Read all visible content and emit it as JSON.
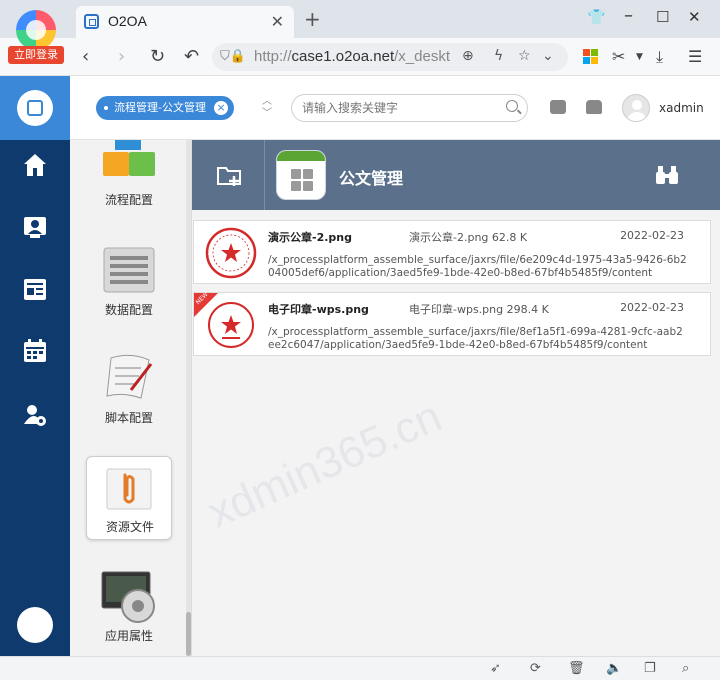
{
  "browser": {
    "login_label": "立即登录",
    "tab_title": "O2OA",
    "url_prefix": "http://",
    "url_host": "case1.o2oa.net",
    "url_path": "/x_deskt",
    "icons": [
      "back-icon",
      "forward-icon",
      "reload-icon",
      "undo-icon",
      "shield-icon",
      "zoom-icon",
      "flash-icon",
      "star-icon",
      "chevron-down-icon",
      "apps-icon",
      "scissors-icon",
      "download-icon",
      "more-icon"
    ]
  },
  "app": {
    "breadcrumb_pill": "流程管理-公文管理",
    "search_placeholder": "请输入搜索关键字",
    "username": "xadmin"
  },
  "nav": {
    "items": [
      "home-icon",
      "contacts-icon",
      "news-icon",
      "calendar-icon",
      "user-settings-icon"
    ]
  },
  "config": {
    "items": [
      {
        "label": "流程配置",
        "icon": "process-config-icon"
      },
      {
        "label": "数据配置",
        "icon": "data-config-icon"
      },
      {
        "label": "脚本配置",
        "icon": "script-config-icon"
      },
      {
        "label": "资源文件",
        "icon": "resource-file-icon",
        "active": true
      },
      {
        "label": "应用属性",
        "icon": "app-properties-icon"
      }
    ]
  },
  "main": {
    "title": "公文管理",
    "files": [
      {
        "name": "演示公章-2.png",
        "meta": "演示公章-2.png 62.8 K",
        "date": "2022-02-23",
        "path": "/x_processplatform_assemble_surface/jaxrs/file/6e209c4d-1975-43a5-9426-6b204005def6/application/3aed5fe9-1bde-42e0-b8ed-67bf4b5485f9/content",
        "new": false
      },
      {
        "name": "电子印章-wps.png",
        "meta": "电子印章-wps.png 298.4 K",
        "date": "2022-02-23",
        "path": "/x_processplatform_assemble_surface/jaxrs/file/8ef1a5f1-699a-4281-9cfc-aab2ee2c6047/application/3aed5fe9-1bde-42e0-b8ed-67bf4b5485f9/content",
        "new": true
      }
    ],
    "new_tag": "NEW"
  },
  "watermark": "xdmin365.cn",
  "colors": {
    "nav_bg": "#0e3a6e",
    "accent_blue": "#3b88d8",
    "header_slate": "#5b718b",
    "seal_red": "#d42a2a"
  }
}
